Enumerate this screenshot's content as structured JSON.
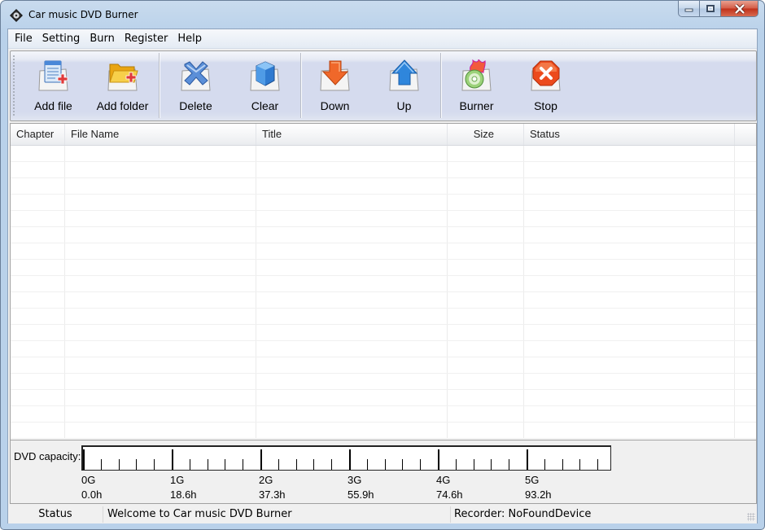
{
  "window": {
    "title": "Car music DVD Burner",
    "app_icon": "dvd-disc-icon",
    "controls": {
      "minimize": "minimize-icon",
      "maximize": "maximize-icon",
      "close": "close-icon"
    }
  },
  "menu": {
    "items": [
      "File",
      "Setting",
      "Burn",
      "Register",
      "Help"
    ]
  },
  "toolbar": {
    "groups": [
      [
        {
          "label": "Add file",
          "icon": "add-file-icon"
        },
        {
          "label": "Add folder",
          "icon": "add-folder-icon"
        }
      ],
      [
        {
          "label": "Delete",
          "icon": "delete-icon"
        },
        {
          "label": "Clear",
          "icon": "clear-icon"
        }
      ],
      [
        {
          "label": "Down",
          "icon": "arrow-down-icon"
        },
        {
          "label": "Up",
          "icon": "arrow-up-icon"
        }
      ],
      [
        {
          "label": "Burner",
          "icon": "burn-disc-icon"
        },
        {
          "label": "Stop",
          "icon": "stop-icon"
        }
      ]
    ]
  },
  "table": {
    "columns": [
      "Chapter",
      "File Name",
      "Title",
      "Size",
      "Status",
      ""
    ],
    "rows": []
  },
  "capacity": {
    "label": "DVD capacity:",
    "gb_labels": [
      "0G",
      "1G",
      "2G",
      "3G",
      "4G",
      "5G"
    ],
    "hour_labels": [
      "0.0h",
      "18.6h",
      "37.3h",
      "55.9h",
      "74.6h",
      "93.2h"
    ],
    "used_fraction": 0
  },
  "statusbar": {
    "status_label": "Status",
    "message": "Welcome to Car music DVD Burner",
    "recorder": "Recorder: NoFoundDevice"
  }
}
